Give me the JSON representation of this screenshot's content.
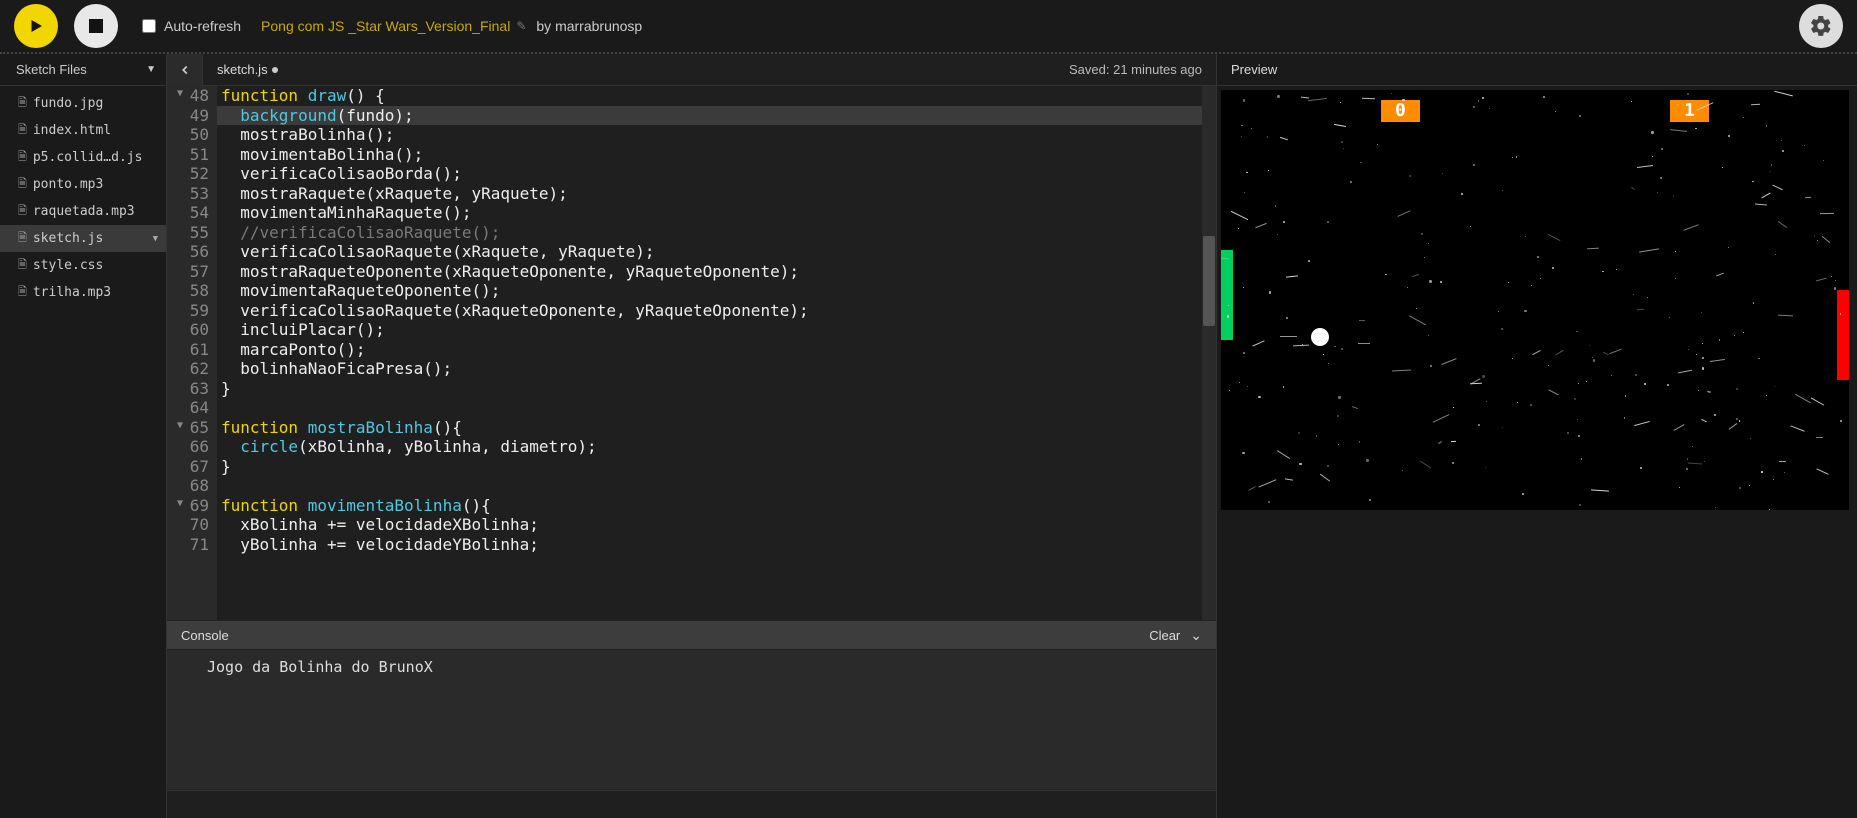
{
  "toolbar": {
    "auto_refresh_label": "Auto-refresh",
    "project_name": "Pong com JS _Star Wars_Version_Final",
    "by_prefix": "by",
    "author": "marrabrunosp"
  },
  "sidebar": {
    "header": "Sketch Files",
    "files": [
      {
        "name": "fundo.jpg",
        "active": false
      },
      {
        "name": "index.html",
        "active": false
      },
      {
        "name": "p5.collid…d.js",
        "active": false
      },
      {
        "name": "ponto.mp3",
        "active": false
      },
      {
        "name": "raquetada.mp3",
        "active": false
      },
      {
        "name": "sketch.js",
        "active": true
      },
      {
        "name": "style.css",
        "active": false
      },
      {
        "name": "trilha.mp3",
        "active": false
      }
    ]
  },
  "editor": {
    "tab_name": "sketch.js",
    "saved_text": "Saved: 21 minutes ago",
    "first_line_no": 48,
    "lines": [
      {
        "n": 48,
        "fold": true,
        "hl": false,
        "html": "<span class='kw'>function</span> <span class='fn'>draw</span><span class='pn'>() {</span>"
      },
      {
        "n": 49,
        "fold": false,
        "hl": true,
        "html": "  <span class='fn'>background</span><span class='pn'>(fundo);</span>"
      },
      {
        "n": 50,
        "fold": false,
        "hl": false,
        "html": "  <span class='id'>mostraBolinha();</span>"
      },
      {
        "n": 51,
        "fold": false,
        "hl": false,
        "html": "  <span class='id'>movimentaBolinha();</span>"
      },
      {
        "n": 52,
        "fold": false,
        "hl": false,
        "html": "  <span class='id'>verificaColisaoBorda();</span>"
      },
      {
        "n": 53,
        "fold": false,
        "hl": false,
        "html": "  <span class='id'>mostraRaquete(xRaquete, yRaquete);</span>"
      },
      {
        "n": 54,
        "fold": false,
        "hl": false,
        "html": "  <span class='id'>movimentaMinhaRaquete();</span>"
      },
      {
        "n": 55,
        "fold": false,
        "hl": false,
        "html": "  <span class='cm'>//verificaColisaoRaquete();</span>"
      },
      {
        "n": 56,
        "fold": false,
        "hl": false,
        "html": "  <span class='id'>verificaColisaoRaquete(xRaquete, yRaquete);</span>"
      },
      {
        "n": 57,
        "fold": false,
        "hl": false,
        "html": "  <span class='id'>mostraRaqueteOponente(xRaqueteOponente, yRaqueteOponente);</span>"
      },
      {
        "n": 58,
        "fold": false,
        "hl": false,
        "html": "  <span class='id'>movimentaRaqueteOponente();</span>"
      },
      {
        "n": 59,
        "fold": false,
        "hl": false,
        "html": "  <span class='id'>verificaColisaoRaquete(xRaqueteOponente, yRaqueteOponente);</span>"
      },
      {
        "n": 60,
        "fold": false,
        "hl": false,
        "html": "  <span class='id'>incluiPlacar();</span>"
      },
      {
        "n": 61,
        "fold": false,
        "hl": false,
        "html": "  <span class='id'>marcaPonto();</span>"
      },
      {
        "n": 62,
        "fold": false,
        "hl": false,
        "html": "  <span class='id'>bolinhaNaoFicaPresa();</span>"
      },
      {
        "n": 63,
        "fold": false,
        "hl": false,
        "html": "<span class='pn'>}</span>"
      },
      {
        "n": 64,
        "fold": false,
        "hl": false,
        "html": ""
      },
      {
        "n": 65,
        "fold": true,
        "hl": false,
        "html": "<span class='kw'>function</span> <span class='fn'>mostraBolinha</span><span class='pn'>(){</span>"
      },
      {
        "n": 66,
        "fold": false,
        "hl": false,
        "html": "  <span class='fn'>circle</span><span class='pn'>(xBolinha, yBolinha, diametro);</span>"
      },
      {
        "n": 67,
        "fold": false,
        "hl": false,
        "html": "<span class='pn'>}</span>"
      },
      {
        "n": 68,
        "fold": false,
        "hl": false,
        "html": ""
      },
      {
        "n": 69,
        "fold": true,
        "hl": false,
        "html": "<span class='kw'>function</span> <span class='fn'>movimentaBolinha</span><span class='pn'>(){</span>"
      },
      {
        "n": 70,
        "fold": false,
        "hl": false,
        "html": "  <span class='id'>xBolinha += velocidadeXBolinha;</span>"
      },
      {
        "n": 71,
        "fold": false,
        "hl": false,
        "html": "  <span class='id'>yBolinha += velocidadeYBolinha;</span>"
      }
    ]
  },
  "console": {
    "title": "Console",
    "clear_label": "Clear",
    "output": "Jogo da Bolinha do BrunoX"
  },
  "preview": {
    "title": "Preview",
    "score_left": "0",
    "score_right": "1"
  }
}
